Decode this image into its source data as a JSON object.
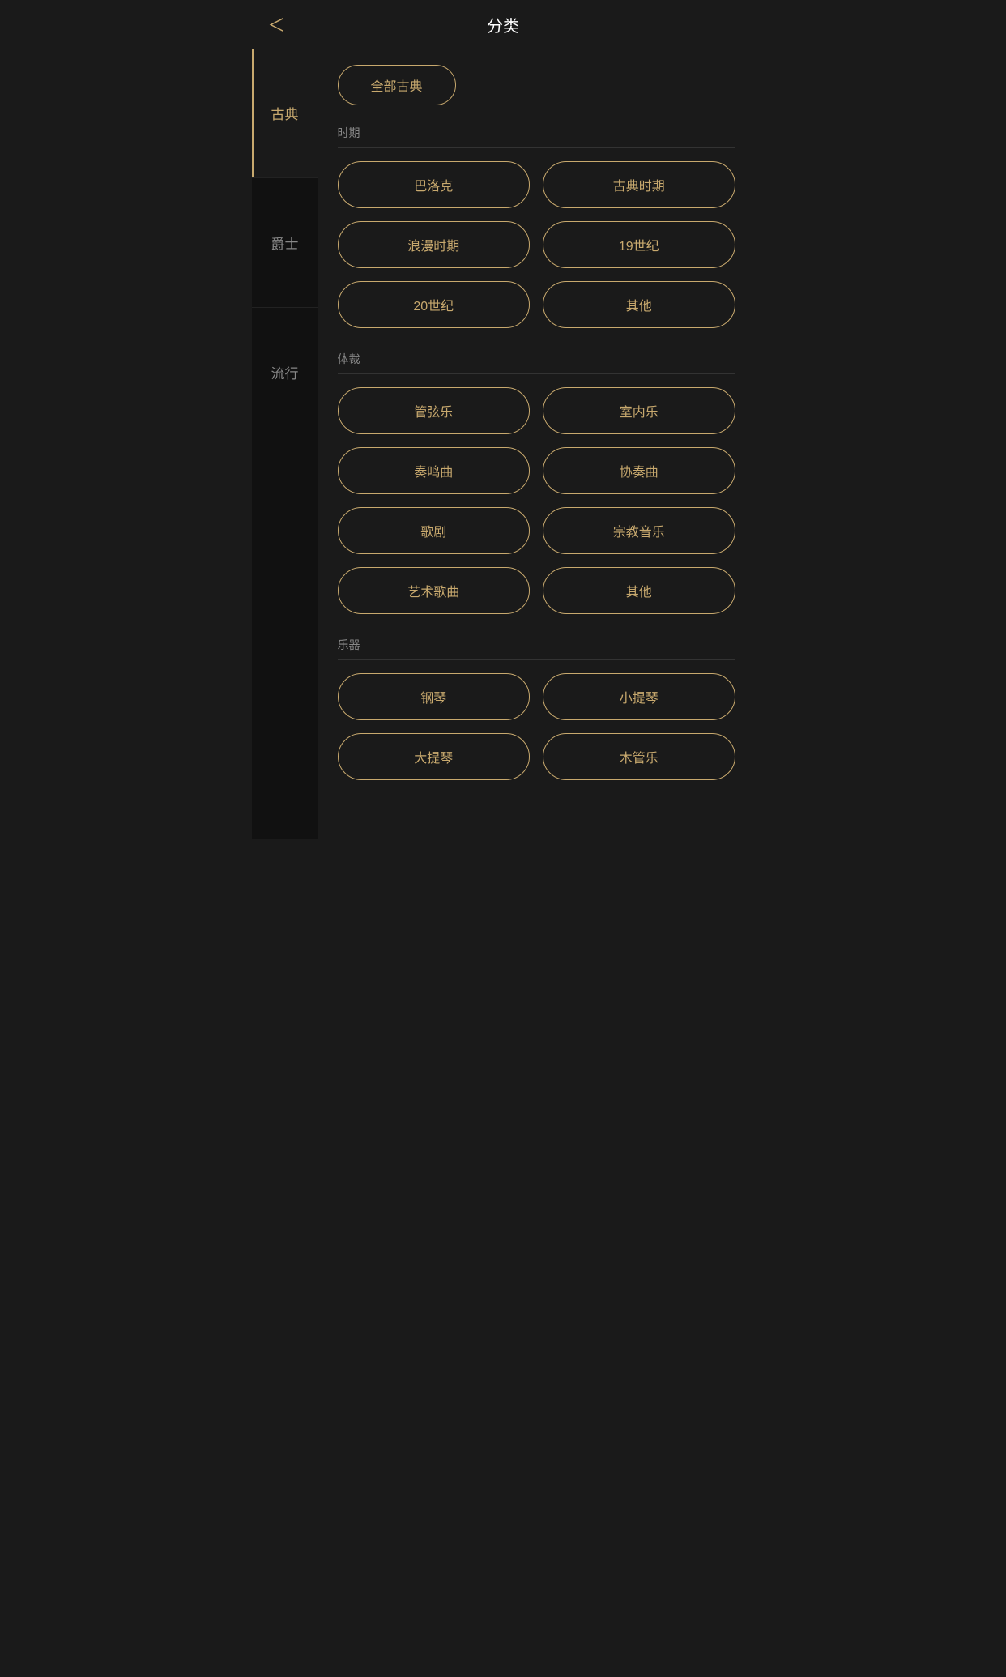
{
  "header": {
    "title": "分类",
    "back_label": "‹"
  },
  "sidebar": {
    "items": [
      {
        "id": "classical",
        "label": "古典",
        "active": true
      },
      {
        "id": "jazz",
        "label": "爵士",
        "active": false
      },
      {
        "id": "pop",
        "label": "流行",
        "active": false
      }
    ]
  },
  "content": {
    "all_button": "全部古典",
    "sections": [
      {
        "id": "period",
        "label": "时期",
        "tags": [
          "巴洛克",
          "古典时期",
          "浪漫时期",
          "19世纪",
          "20世纪",
          "其他"
        ]
      },
      {
        "id": "genre",
        "label": "体裁",
        "tags": [
          "管弦乐",
          "室内乐",
          "奏鸣曲",
          "协奏曲",
          "歌剧",
          "宗教音乐",
          "艺术歌曲",
          "其他"
        ]
      },
      {
        "id": "instrument",
        "label": "乐器",
        "tags": [
          "钢琴",
          "小提琴",
          "大提琴",
          "木管乐"
        ]
      }
    ]
  }
}
